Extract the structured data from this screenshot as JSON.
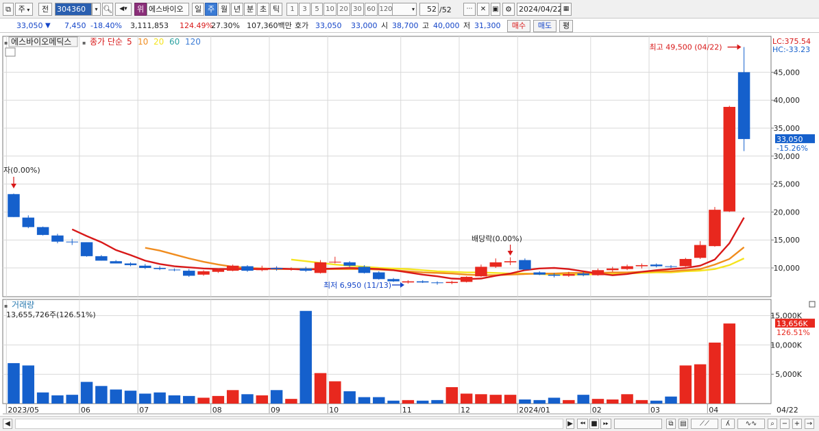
{
  "toolbar": {
    "market": "주",
    "prev": "전",
    "code": "304360",
    "rank_badge": "위",
    "stock_name": "에스바이오",
    "periods": [
      "일",
      "주",
      "월",
      "년",
      "분",
      "초",
      "틱"
    ],
    "active_period": "주",
    "intervals": [
      "1",
      "3",
      "5",
      "10",
      "20",
      "30",
      "60",
      "120"
    ],
    "page": "52",
    "page_total": "/52",
    "date": "2024/04/22"
  },
  "info": {
    "price": "33,050",
    "change": "7,450",
    "change_pct": "-18.40%",
    "volume": "3,111,853",
    "vol_ratio": "124.49%",
    "turnover": "27.30%",
    "amount": "107,360백만",
    "ask_label": "호가",
    "ask": "33,050",
    "bid": "33,000",
    "open_label": "시",
    "open": "38,700",
    "high_label": "고",
    "high": "40,000",
    "low_label": "저",
    "low": "31,300",
    "buy": "매수",
    "sell": "매도",
    "flat": "평"
  },
  "price_panel": {
    "stock_label": "에스바이오메딕스",
    "ma_label": "종가 단순",
    "ma_periods": [
      "5",
      "10",
      "20",
      "60",
      "120"
    ],
    "lc": "LC:375.54",
    "hc": "HC:-33.23",
    "current_tag": "33,050",
    "current_pct": "-15.26%",
    "high_annot": "최고 49,500 (04/22)",
    "low_annot": "최저 6,950 (11/13)",
    "event1": "자(0.00%)",
    "event2": "배당락(0.00%)"
  },
  "volume_panel": {
    "title": "거래량",
    "value": "13,655,726주(126.51%)",
    "tag_value": "13,656K",
    "tag_pct": "126.51%"
  },
  "colors": {
    "up": "#e8281e",
    "down": "#1560cc",
    "ma5": "#d81818",
    "ma10": "#f08c1e",
    "ma20": "#f5e41e",
    "grid": "#d8d8d8"
  },
  "chart_data": {
    "type": "candlestick",
    "price_axis": {
      "ticks": [
        10000,
        15000,
        20000,
        25000,
        30000,
        35000,
        40000,
        45000
      ],
      "labels": [
        "10,000",
        "15,000",
        "20,000",
        "25,000",
        "30,000",
        "35,000",
        "40,000",
        "45,000"
      ]
    },
    "volume_axis": {
      "ticks": [
        5000,
        10000,
        15000
      ],
      "labels": [
        "5,000K",
        "10,000K",
        "15,000K"
      ]
    },
    "x_labels": [
      {
        "i": 0,
        "text": "2023/05"
      },
      {
        "i": 5,
        "text": "06"
      },
      {
        "i": 9,
        "text": "07"
      },
      {
        "i": 14,
        "text": "08"
      },
      {
        "i": 18,
        "text": "09"
      },
      {
        "i": 22,
        "text": "10"
      },
      {
        "i": 27,
        "text": "11"
      },
      {
        "i": 31,
        "text": "12"
      },
      {
        "i": 35,
        "text": "2024/01"
      },
      {
        "i": 40,
        "text": "02"
      },
      {
        "i": 44,
        "text": "03"
      },
      {
        "i": 48,
        "text": "04"
      }
    ],
    "last_date_label": "04/22",
    "candles": [
      [
        23200,
        23300,
        19100,
        19100
      ],
      [
        19000,
        19400,
        17100,
        17300
      ],
      [
        17300,
        17400,
        15800,
        15900
      ],
      [
        15800,
        16100,
        14400,
        14700
      ],
      [
        14700,
        15200,
        14100,
        14600
      ],
      [
        14600,
        14600,
        12000,
        12100
      ],
      [
        12100,
        12300,
        11300,
        11300
      ],
      [
        11200,
        11400,
        10800,
        10800
      ],
      [
        10800,
        11000,
        10300,
        10500
      ],
      [
        10400,
        10700,
        9800,
        10000
      ],
      [
        10000,
        10300,
        9600,
        9800
      ],
      [
        9700,
        9900,
        9400,
        9600
      ],
      [
        9500,
        9800,
        8400,
        8600
      ],
      [
        8800,
        9600,
        8600,
        9400
      ],
      [
        9300,
        9900,
        9100,
        9700
      ],
      [
        9500,
        10600,
        9400,
        10400
      ],
      [
        10300,
        10500,
        9300,
        9500
      ],
      [
        9600,
        10400,
        9400,
        10000
      ],
      [
        10000,
        10300,
        9500,
        9800
      ],
      [
        9700,
        10100,
        9500,
        9800
      ],
      [
        9900,
        10200,
        9300,
        9500
      ],
      [
        9100,
        11400,
        9000,
        11000
      ],
      [
        11000,
        12000,
        10800,
        11100
      ],
      [
        11000,
        11200,
        10200,
        10400
      ],
      [
        10200,
        10500,
        9000,
        9100
      ],
      [
        9200,
        9400,
        7900,
        8000
      ],
      [
        8000,
        8200,
        7500,
        7600
      ],
      [
        7400,
        7800,
        7200,
        7600
      ],
      [
        7600,
        7800,
        7300,
        7400
      ],
      [
        7400,
        7600,
        7000,
        7300
      ],
      [
        7300,
        7700,
        7100,
        7500
      ],
      [
        7500,
        8500,
        7400,
        8400
      ],
      [
        8500,
        10600,
        8400,
        10200
      ],
      [
        10200,
        11700,
        10000,
        11000
      ],
      [
        11000,
        11900,
        10500,
        11200
      ],
      [
        11400,
        11700,
        9600,
        9700
      ],
      [
        9200,
        9400,
        8700,
        8800
      ],
      [
        8800,
        9100,
        8300,
        8600
      ],
      [
        8600,
        9300,
        8400,
        8900
      ],
      [
        9000,
        9300,
        8500,
        8700
      ],
      [
        8700,
        9900,
        8600,
        9600
      ],
      [
        9600,
        10200,
        9300,
        9900
      ],
      [
        9800,
        10600,
        9600,
        10300
      ],
      [
        10300,
        10800,
        9900,
        10500
      ],
      [
        10600,
        10800,
        10100,
        10300
      ],
      [
        10300,
        10500,
        10000,
        10200
      ],
      [
        10300,
        11800,
        10200,
        11600
      ],
      [
        11800,
        14800,
        11600,
        14100
      ],
      [
        13900,
        20900,
        13800,
        20400
      ],
      [
        20100,
        39000,
        20000,
        38800
      ],
      [
        45000,
        49500,
        30900,
        33050
      ]
    ],
    "volume_k": [
      6900,
      6500,
      1900,
      1400,
      1500,
      3700,
      3000,
      2400,
      2200,
      1700,
      1900,
      1400,
      1300,
      1000,
      1300,
      2300,
      1600,
      1400,
      2300,
      800,
      15800,
      5200,
      3800,
      2100,
      1100,
      1100,
      500,
      600,
      500,
      600,
      2800,
      1700,
      1600,
      1500,
      1500,
      700,
      600,
      1000,
      600,
      1500,
      800,
      700,
      1600,
      600,
      500,
      1200,
      6500,
      6700,
      10400,
      13656
    ],
    "ma5": [
      null,
      null,
      null,
      null,
      16900,
      15700,
      14600,
      13200,
      12300,
      11300,
      10700,
      10300,
      10100,
      9900,
      9800,
      9800,
      9800,
      9800,
      9900,
      9800,
      9700,
      9800,
      9900,
      10000,
      9900,
      9800,
      9600,
      9200,
      8800,
      8500,
      8100,
      8000,
      8100,
      8600,
      9000,
      9600,
      9900,
      10000,
      9800,
      9400,
      9000,
      8700,
      8900,
      9300,
      9600,
      9800,
      10000,
      10400,
      11500,
      14400,
      19000,
      23700
    ],
    "ma10": [
      null,
      null,
      null,
      null,
      null,
      null,
      null,
      null,
      null,
      13600,
      13100,
      12400,
      11700,
      11100,
      10600,
      10200,
      10000,
      9900,
      9800,
      9800,
      9800,
      9800,
      9800,
      9800,
      9800,
      9700,
      9600,
      9400,
      9200,
      9100,
      9000,
      8800,
      8700,
      8700,
      8800,
      8900,
      9000,
      9000,
      9100,
      9100,
      9100,
      9200,
      9200,
      9300,
      9400,
      9400,
      9600,
      9800,
      10600,
      11600,
      13700,
      16800
    ],
    "ma20": [
      null,
      null,
      null,
      null,
      null,
      null,
      null,
      null,
      null,
      null,
      null,
      null,
      null,
      null,
      null,
      null,
      null,
      null,
      null,
      11500,
      11200,
      10900,
      10600,
      10400,
      10200,
      10000,
      9900,
      9800,
      9600,
      9400,
      9300,
      9200,
      9200,
      9100,
      9000,
      9000,
      8900,
      8800,
      8800,
      8800,
      8900,
      8900,
      9000,
      9100,
      9200,
      9200,
      9400,
      9500,
      9800,
      10500,
      11700,
      13100
    ]
  }
}
